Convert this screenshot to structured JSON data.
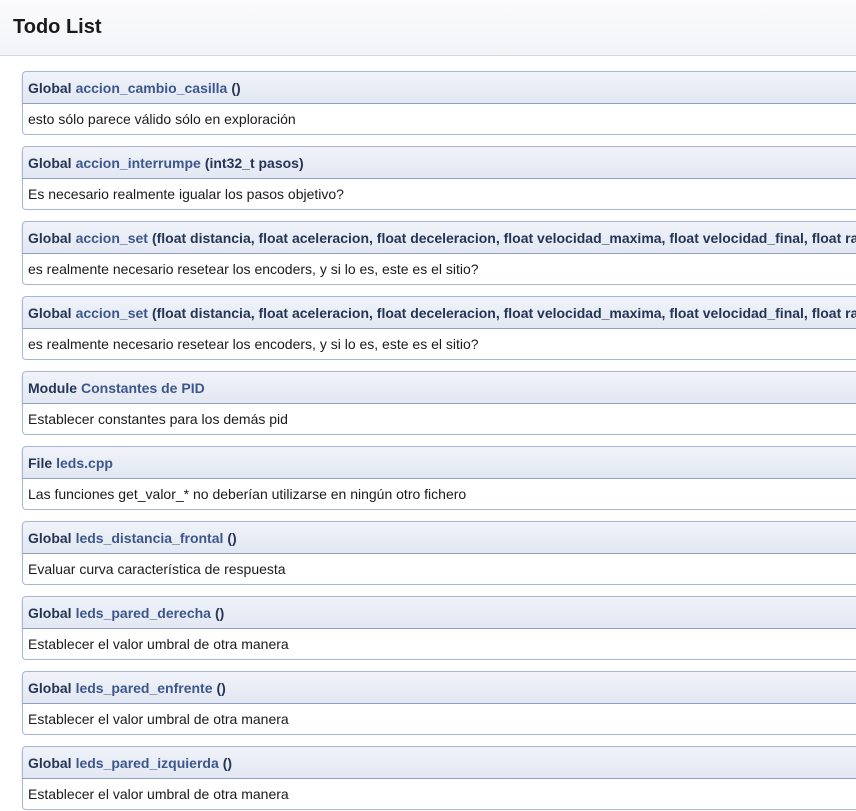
{
  "page": {
    "title": "Todo List"
  },
  "items": [
    {
      "kind": "Global",
      "link": "accion_cambio_casilla",
      "args": "()",
      "text": "esto sólo parece válido sólo en exploración"
    },
    {
      "kind": "Global",
      "link": "accion_interrumpe",
      "args": "(int32_t pasos)",
      "text": "Es necesario realmente igualar los pasos objetivo?"
    },
    {
      "kind": "Global",
      "link": "accion_set",
      "args": "(float distancia, float aceleracion, float deceleracion, float velocidad_maxima, float velocidad_final, float radio)",
      "text": "es realmente necesario resetear los encoders, y si lo es, este es el sitio?"
    },
    {
      "kind": "Global",
      "link": "accion_set",
      "args": "(float distancia, float aceleracion, float deceleracion, float velocidad_maxima, float velocidad_final, float radio)",
      "text": "es realmente necesario resetear los encoders, y si lo es, este es el sitio?"
    },
    {
      "kind": "Module",
      "link": "Constantes de PID",
      "args": "",
      "text": "Establecer constantes para los demás pid"
    },
    {
      "kind": "File",
      "link": "leds.cpp",
      "args": "",
      "text": "Las funciones get_valor_* no deberían utilizarse en ningún otro fichero"
    },
    {
      "kind": "Global",
      "link": "leds_distancia_frontal",
      "args": "()",
      "text": "Evaluar curva característica de respuesta"
    },
    {
      "kind": "Global",
      "link": "leds_pared_derecha",
      "args": "()",
      "text": "Establecer el valor umbral de otra manera"
    },
    {
      "kind": "Global",
      "link": "leds_pared_enfrente",
      "args": "()",
      "text": "Establecer el valor umbral de otra manera"
    },
    {
      "kind": "Global",
      "link": "leds_pared_izquierda",
      "args": "()",
      "text": "Establecer el valor umbral de otra manera"
    }
  ],
  "colors": {
    "link": "#3d578c",
    "header_text": "#253555",
    "border": "#a9b6d3"
  }
}
